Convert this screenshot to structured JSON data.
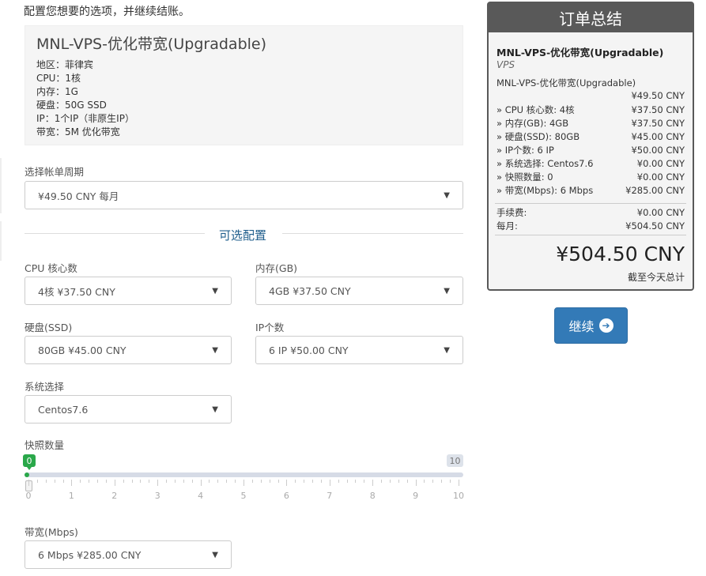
{
  "intro": "配置您想要的选项，并继续结账。",
  "product": {
    "title": "MNL-VPS-优化带宽(Upgradable)",
    "specs": [
      "地区：菲律宾",
      "CPU：1核",
      "内存：1G",
      "硬盘：50G SSD",
      "IP：1个IP（非原生IP）",
      "带宽：5M 优化带宽"
    ]
  },
  "billing": {
    "label": "选择帐单周期",
    "value": "¥49.50 CNY 每月"
  },
  "options_title": "可选配置",
  "options": {
    "cpu": {
      "label": "CPU 核心数",
      "value": "4核 ¥37.50 CNY"
    },
    "ram": {
      "label": "内存(GB)",
      "value": "4GB ¥37.50 CNY"
    },
    "disk": {
      "label": "硬盘(SSD)",
      "value": "80GB ¥45.00 CNY"
    },
    "ip": {
      "label": "IP个数",
      "value": "6 IP ¥50.00 CNY"
    },
    "os": {
      "label": "系统选择",
      "value": "Centos7.6"
    },
    "snapshot": {
      "label": "快照数量",
      "value": "0",
      "max": "10",
      "ticks": [
        "0",
        "1",
        "2",
        "3",
        "4",
        "5",
        "6",
        "7",
        "8",
        "9",
        "10"
      ]
    },
    "bandwidth": {
      "label": "带宽(Mbps)",
      "value": "6 Mbps ¥285.00 CNY"
    }
  },
  "summary": {
    "title": "订单总结",
    "product": "MNL-VPS-优化带宽(Upgradable)",
    "category": "VPS",
    "subproduct": "MNL-VPS-优化带宽(Upgradable)",
    "base_price": "¥49.50 CNY",
    "lines": [
      {
        "label": "» CPU 核心数: 4核",
        "price": "¥37.50 CNY"
      },
      {
        "label": "» 内存(GB): 4GB",
        "price": "¥37.50 CNY"
      },
      {
        "label": "» 硬盘(SSD): 80GB",
        "price": "¥45.00 CNY"
      },
      {
        "label": "» IP个数: 6 IP",
        "price": "¥50.00 CNY"
      },
      {
        "label": "» 系统选择: Centos7.6",
        "price": "¥0.00 CNY"
      },
      {
        "label": "» 快照数量: 0",
        "price": "¥0.00 CNY"
      },
      {
        "label": "» 带宽(Mbps): 6 Mbps",
        "price": "¥285.00 CNY"
      }
    ],
    "setup_label": "手续费:",
    "setup_price": "¥0.00 CNY",
    "monthly_label": "每月:",
    "monthly_price": "¥504.50 CNY",
    "total": "¥504.50 CNY",
    "total_label": "截至今天总计"
  },
  "continue_label": "继续",
  "colors": {
    "accent": "#337ab7",
    "slider": "#2aa84a",
    "summary_header": "#595959",
    "section_title": "#1f5e8c"
  }
}
